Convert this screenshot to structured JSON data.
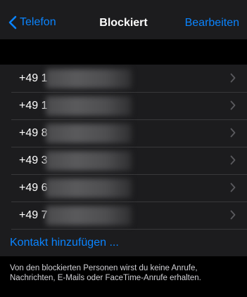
{
  "nav": {
    "back_label": "Telefon",
    "title": "Blockiert",
    "edit_label": "Bearbeiten"
  },
  "blocked": [
    {
      "number": "+49 1"
    },
    {
      "number": "+49 1"
    },
    {
      "number": "+49 8"
    },
    {
      "number": "+49 3"
    },
    {
      "number": "+49 6"
    },
    {
      "number": "+49 7"
    }
  ],
  "add_contact_label": "Kontakt hinzufügen ...",
  "footer_text": "Von den blockierten Personen wirst du keine Anrufe, Nachrichten, E-Mails oder FaceTime-Anrufe erhalten.",
  "colors": {
    "accent": "#0a84ff",
    "background": "#000000",
    "cell": "#1c1c1e",
    "separator": "#38383a"
  },
  "icons": {
    "back": "chevron-left-icon",
    "row": "chevron-right-icon"
  }
}
